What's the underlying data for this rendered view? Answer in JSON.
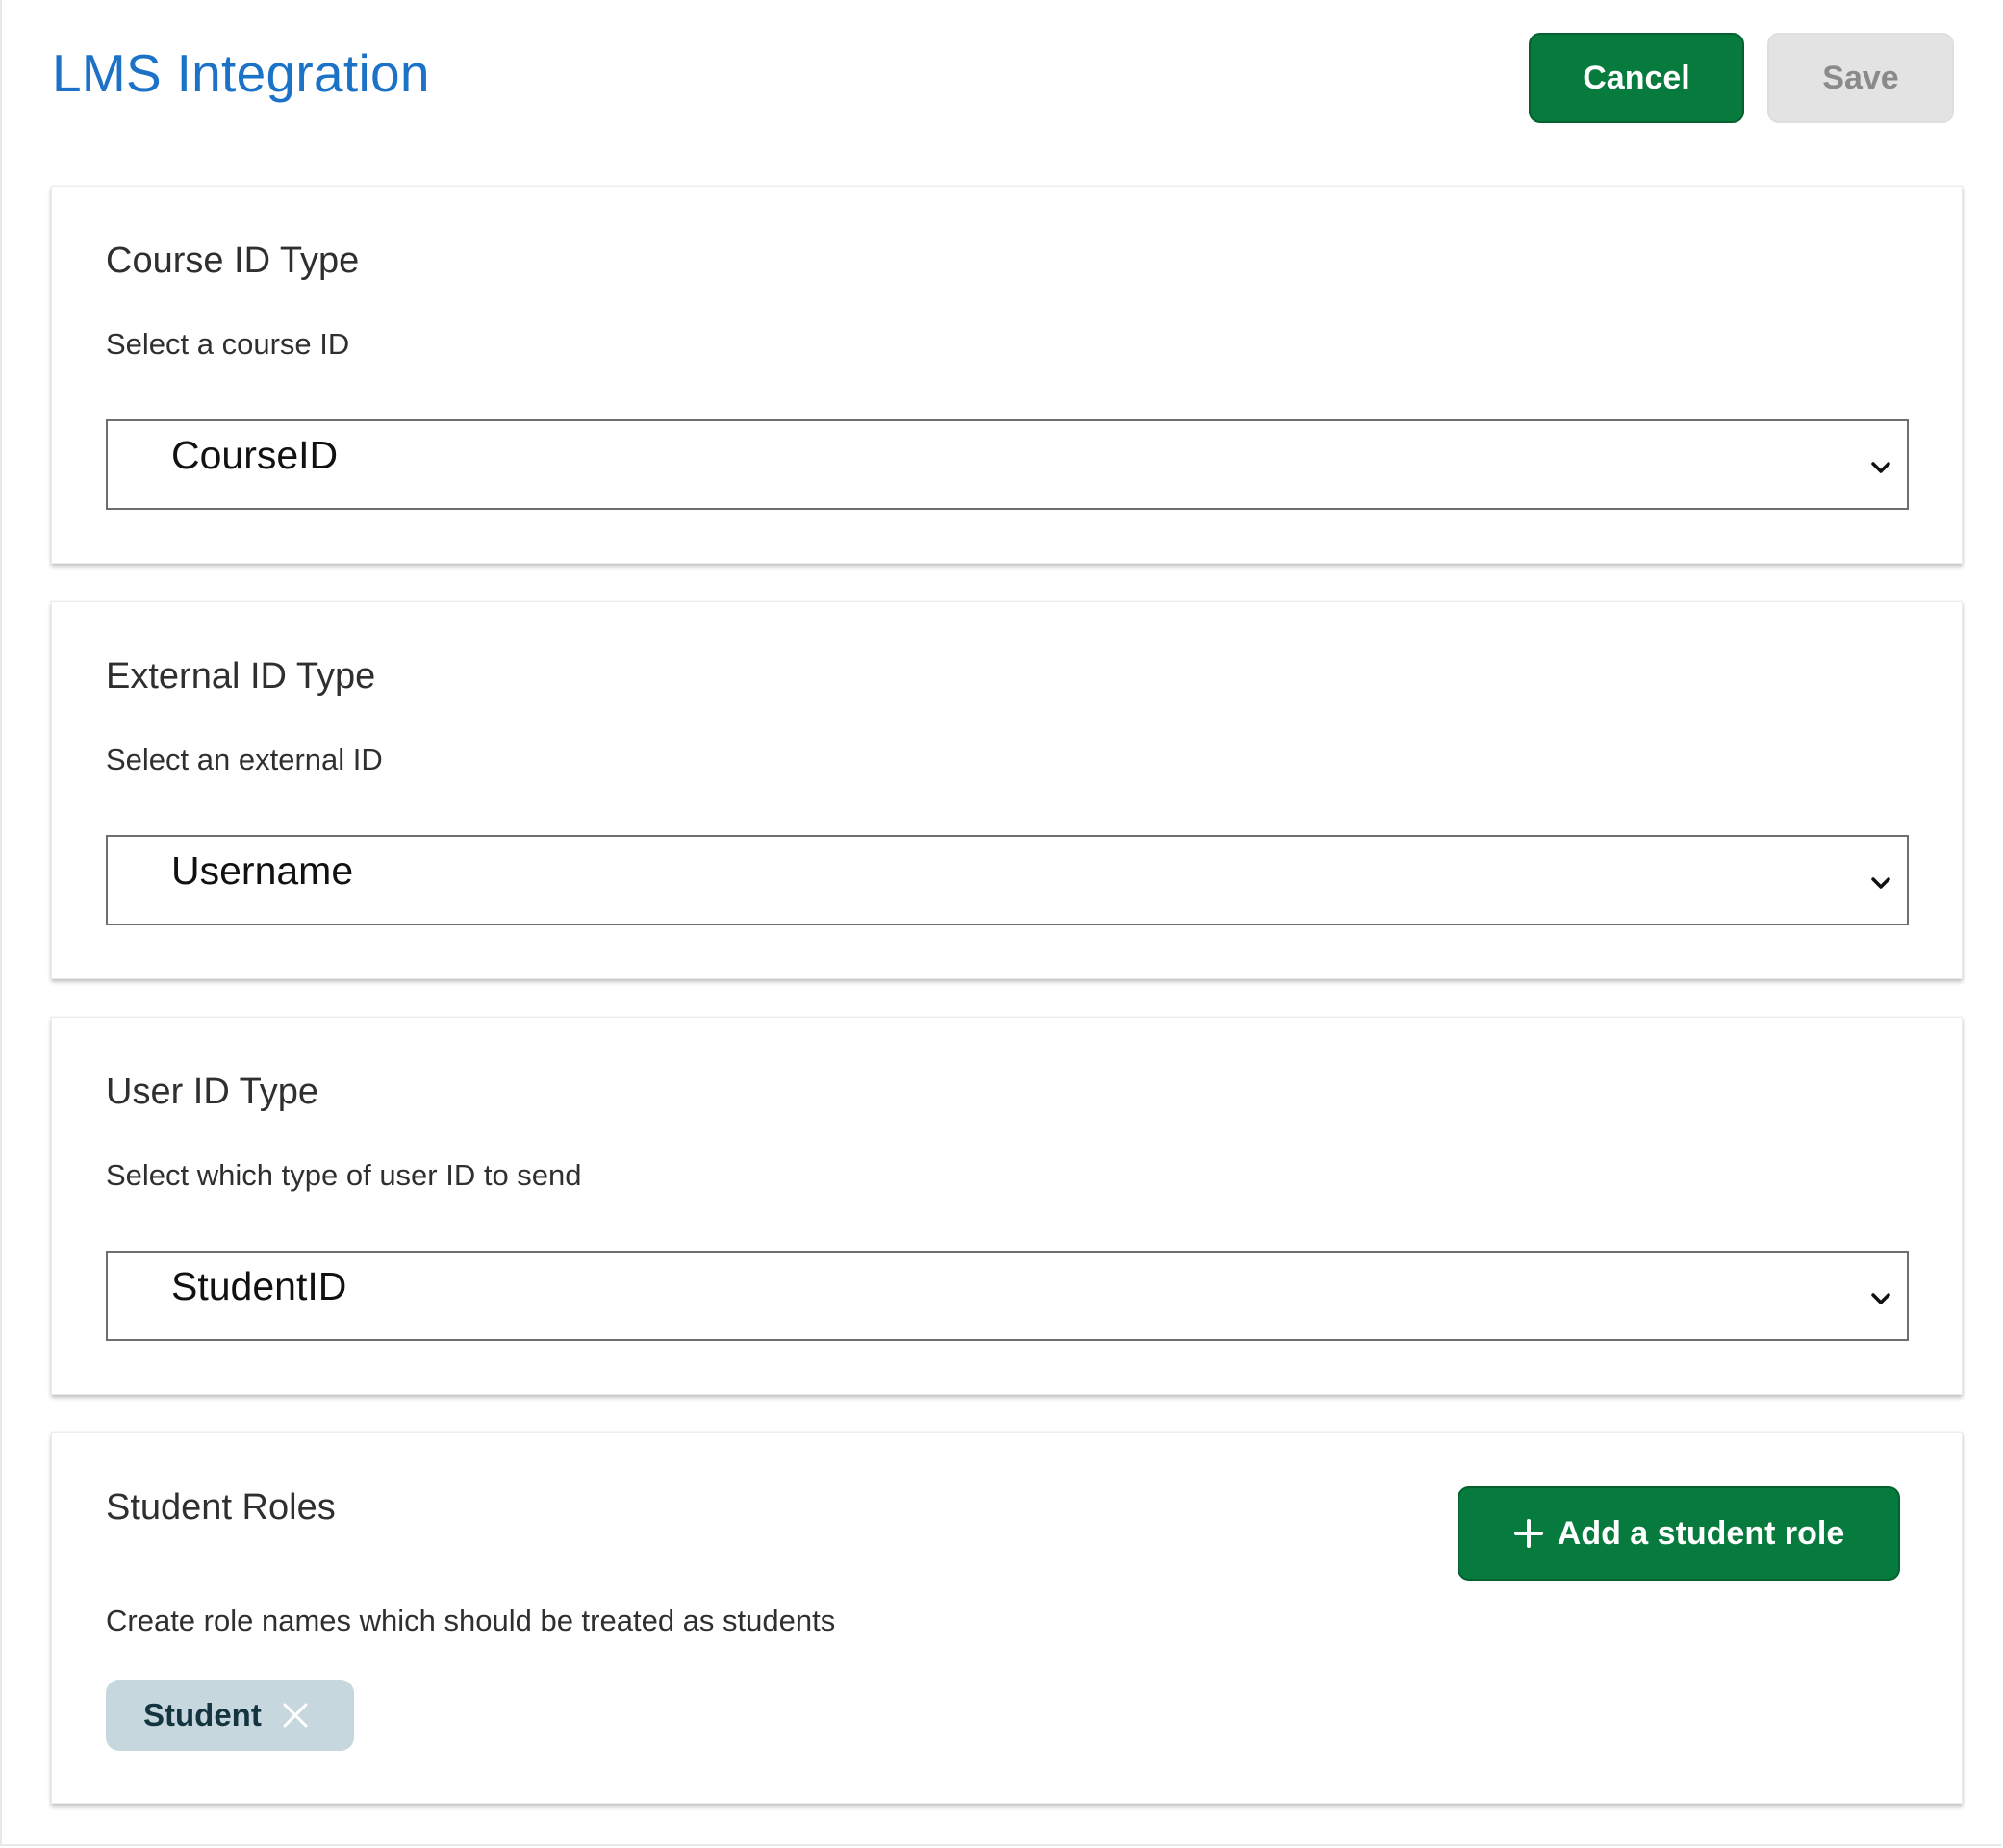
{
  "header": {
    "title": "LMS Integration",
    "cancel_label": "Cancel",
    "save_label": "Save"
  },
  "sections": {
    "course": {
      "title": "Course ID Type",
      "subtitle": "Select a course ID",
      "selected": "CourseID"
    },
    "external": {
      "title": "External ID Type",
      "subtitle": "Select an external ID",
      "selected": "Username"
    },
    "user": {
      "title": "User ID Type",
      "subtitle": "Select which type of user ID to send",
      "selected": "StudentID"
    },
    "roles": {
      "title": "Student Roles",
      "add_label": "Add a student role",
      "subtitle": "Create role names which should be treated as students",
      "chips": [
        "Student"
      ]
    }
  },
  "colors": {
    "accent_green": "#067b3d",
    "title_blue": "#1b72c7",
    "disabled_gray": "#e3e3e3",
    "chip_bg": "#c6d7de"
  },
  "icons": {
    "select_chevron": "chevron-down-icon",
    "add": "plus-icon",
    "chip_remove": "close-icon"
  }
}
